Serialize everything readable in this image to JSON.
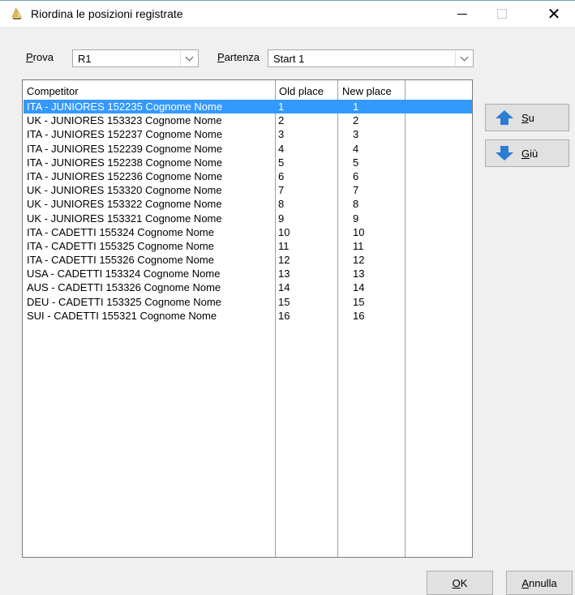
{
  "window": {
    "title": "Riordina le posizioni registrate",
    "icons": {
      "app": "sailboat-icon",
      "minimize": "minimize-icon",
      "maximize": "maximize-icon",
      "close": "close-icon"
    },
    "close_glyph": "✕"
  },
  "filters": {
    "prova_label_accel": "P",
    "prova_label_rest": "rova",
    "prova_value": "R1",
    "partenza_label_accel": "P",
    "partenza_label_rest": "artenza",
    "partenza_value": "Start 1"
  },
  "list": {
    "columns": [
      "Competitor",
      "Old place",
      "New place"
    ],
    "selected_index": 0,
    "rows": [
      {
        "competitor": "ITA - JUNIORES 152235 Cognome Nome",
        "old": "1",
        "new": "1"
      },
      {
        "competitor": "UK - JUNIORES 153323 Cognome Nome",
        "old": "2",
        "new": "2"
      },
      {
        "competitor": "ITA - JUNIORES 152237 Cognome Nome",
        "old": "3",
        "new": "3"
      },
      {
        "competitor": "ITA - JUNIORES 152239 Cognome Nome",
        "old": "4",
        "new": "4"
      },
      {
        "competitor": "ITA - JUNIORES 152238 Cognome Nome",
        "old": "5",
        "new": "5"
      },
      {
        "competitor": "ITA - JUNIORES 152236 Cognome Nome",
        "old": "6",
        "new": "6"
      },
      {
        "competitor": "UK - JUNIORES 153320 Cognome Nome",
        "old": "7",
        "new": "7"
      },
      {
        "competitor": "UK - JUNIORES 153322 Cognome Nome",
        "old": "8",
        "new": "8"
      },
      {
        "competitor": "UK - JUNIORES 153321 Cognome Nome",
        "old": "9",
        "new": "9"
      },
      {
        "competitor": "ITA - CADETTI 155324 Cognome Nome",
        "old": "10",
        "new": "10"
      },
      {
        "competitor": "ITA - CADETTI 155325 Cognome Nome",
        "old": "11",
        "new": "11"
      },
      {
        "competitor": "ITA - CADETTI 155326 Cognome Nome",
        "old": "12",
        "new": "12"
      },
      {
        "competitor": "USA - CADETTI 153324 Cognome Nome",
        "old": "13",
        "new": "13"
      },
      {
        "competitor": "AUS - CADETTI 153326 Cognome Nome",
        "old": "14",
        "new": "14"
      },
      {
        "competitor": "DEU - CADETTI 153325 Cognome Nome",
        "old": "15",
        "new": "15"
      },
      {
        "competitor": "SUI - CADETTI 155321 Cognome Nome",
        "old": "16",
        "new": "16"
      }
    ]
  },
  "buttons": {
    "up_accel": "S",
    "up_rest": "u",
    "up_icon": "arrow-up-icon",
    "down_accel": "G",
    "down_rest": "iù",
    "down_icon": "arrow-down-icon",
    "ok_accel": "O",
    "ok_rest": "K",
    "cancel_accel": "A",
    "cancel_rest": "nnulla"
  },
  "colors": {
    "selection": "#3399ff",
    "arrow": "#2b7cd3"
  }
}
